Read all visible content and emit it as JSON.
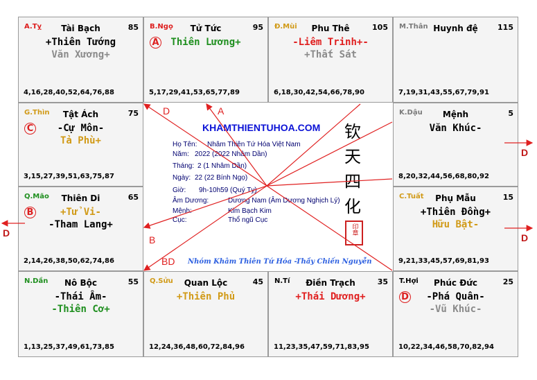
{
  "cells": [
    {
      "branch": "A.Tỵ",
      "branch_color": "#dd1f1f",
      "palace": "Tài Bạch",
      "num": "85",
      "stars": [
        {
          "text": "+Thiên Tướng",
          "color": "#000000"
        },
        {
          "text": "Văn Xương+",
          "color": "#8a8a8a"
        }
      ],
      "ages": "4,16,28,40,52,64,76,88"
    },
    {
      "branch": "B.Ngọ",
      "branch_color": "#dd1f1f",
      "palace": "Tử Tức",
      "num": "95",
      "circle": "A",
      "stars": [
        {
          "text": "Thiên Lương+",
          "color": "#1f8f1f"
        }
      ],
      "ages": "5,17,29,41,53,65,77,89"
    },
    {
      "branch": "Đ.Mùi",
      "branch_color": "#d19a17",
      "palace": "Phu Thê",
      "num": "105",
      "stars": [
        {
          "text": "-Liêm Trinh+-",
          "color": "#e02020"
        },
        {
          "text": "+Thất Sát",
          "color": "#8a8a8a"
        }
      ],
      "ages": "6,18,30,42,54,66,78,90"
    },
    {
      "branch": "M.Thân",
      "branch_color": "#7a7a7a",
      "palace": "Huynh đệ",
      "num": "115",
      "stars": [],
      "ages": "7,19,31,43,55,67,79,91"
    },
    {
      "branch": "G.Thìn",
      "branch_color": "#d19a17",
      "palace": "Tật Ách",
      "num": "75",
      "circle": "C",
      "stars": [
        {
          "text": "-Cự Môn-",
          "color": "#000000"
        },
        {
          "text": "Tả Phù+",
          "color": "#d19a17"
        }
      ],
      "ages": "3,15,27,39,51,63,75,87"
    },
    {
      "branch": "K.Dậu",
      "branch_color": "#7a7a7a",
      "palace": "Mệnh",
      "num": "5",
      "stars": [
        {
          "text": "Văn Khúc-",
          "color": "#000000"
        }
      ],
      "ages": "8,20,32,44,56,68,80,92"
    },
    {
      "branch": "Q.Mão",
      "branch_color": "#1f8f1f",
      "palace": "Thiên Di",
      "num": "65",
      "circle": "B",
      "stars": [
        {
          "text": "+Tử Vi-",
          "color": "#d19a17"
        },
        {
          "text": "-Tham Lang+",
          "color": "#000000"
        }
      ],
      "ages": "2,14,26,38,50,62,74,86"
    },
    {
      "branch": "C.Tuất",
      "branch_color": "#d19a17",
      "palace": "Phụ Mẫu",
      "num": "15",
      "stars": [
        {
          "text": "+Thiên Đồng+",
          "color": "#000000"
        },
        {
          "text": "Hữu Bật-",
          "color": "#d19a17"
        }
      ],
      "ages": "9,21,33,45,57,69,81,93"
    },
    {
      "branch": "N.Dần",
      "branch_color": "#1f8f1f",
      "palace": "Nô Bộc",
      "num": "55",
      "stars": [
        {
          "text": "-Thái Âm-",
          "color": "#000000"
        },
        {
          "text": "-Thiên Cơ+",
          "color": "#1f8f1f"
        }
      ],
      "ages": "1,13,25,37,49,61,73,85"
    },
    {
      "branch": "Q.Sửu",
      "branch_color": "#d19a17",
      "palace": "Quan Lộc",
      "num": "45",
      "stars": [
        {
          "text": "+Thiên Phủ",
          "color": "#d19a17"
        }
      ],
      "ages": "12,24,36,48,60,72,84,96"
    },
    {
      "branch": "N.Tí",
      "branch_color": "#000000",
      "palace": "Điền Trạch",
      "num": "35",
      "stars": [
        {
          "text": "+Thái Dương+",
          "color": "#e02020"
        }
      ],
      "ages": "11,23,35,47,59,71,83,95"
    },
    {
      "branch": "T.Hợi",
      "branch_color": "#000000",
      "palace": "Phúc Đức",
      "num": "25",
      "circle": "D",
      "stars": [
        {
          "text": "-Phá Quân-",
          "color": "#000000"
        },
        {
          "text": "-Vũ Khúc-",
          "color": "#8a8a8a"
        }
      ],
      "ages": "10,22,34,46,58,70,82,94"
    }
  ],
  "center": {
    "brand": "KHAMTHIENTUHOA.COM",
    "vertical_chars": [
      "钦",
      "天",
      "四",
      "化"
    ],
    "seal_text": "印章",
    "info": [
      {
        "label": "Họ Tên:",
        "value": "Nhâm Thiên Tứ Hóa Việt Nam"
      },
      {
        "label": "Năm:",
        "value": "2022  (2022 Nhâm  Dần)"
      },
      {
        "label": "Tháng:",
        "value": "2  (1 Nhâm Dần)"
      },
      {
        "label": "Ngày:",
        "value": "22  (22 Bính Ngọ)"
      },
      {
        "label": "Giờ:",
        "value": "9h-10h59 (Quý Tỵ)"
      },
      {
        "label": "Âm Dương:",
        "value": "Dương Nam (Âm Dương Nghịch Lý)"
      },
      {
        "label": "Mệnh:",
        "value": "Kim Bạch Kim"
      },
      {
        "label": "Cục:",
        "value": "Thổ ngũ Cục"
      }
    ],
    "footer": "Nhóm Khâm Thiên Tứ Hóa -Thầy Chiến Nguyễn"
  },
  "arrow_labels": {
    "d_top": "D",
    "a_top": "A",
    "b_left": "B",
    "bd_bottom": "BD",
    "d_out": "D"
  }
}
